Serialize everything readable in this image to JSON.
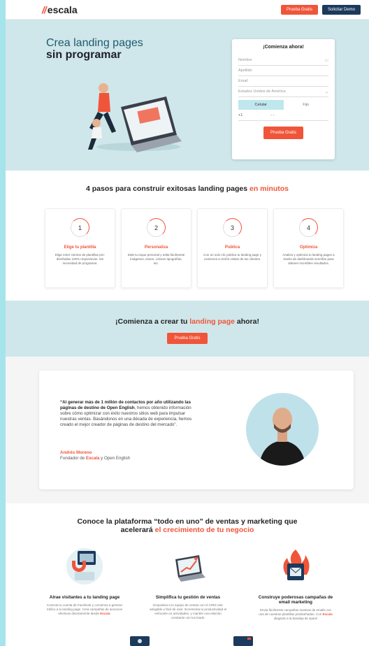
{
  "header": {
    "logo_text": "escala",
    "btn_trial": "Prueba Gratis",
    "btn_demo": "Solicitar Demo"
  },
  "hero": {
    "title_line1": "Crea landing pages",
    "title_line2": "sin programar",
    "form": {
      "title": "¡Comienza ahora!",
      "name_placeholder": "Nombre",
      "lastname_placeholder": "Apellido",
      "email_placeholder": "Email",
      "country_value": "Estados Unidos de América",
      "tab_mobile": "Celular",
      "tab_landline": "Fijo",
      "phone_prefix": "+1",
      "phone_mask": "- -",
      "submit": "Prueba Gratis"
    }
  },
  "steps": {
    "title_main": "4 pasos para construir exitosas landing pages ",
    "title_highlight": "en minutos",
    "items": [
      {
        "num": "1",
        "title": "Elige tu plantilla",
        "desc": "Elige entre cientos de plantillas pre-diseñadas 100% responsivas. Sin necesidad de programar."
      },
      {
        "num": "2",
        "title": "Personaliza",
        "desc": "Dale tu toque personal y edita fácilmente imágenes, textos, colores tipografías, etc."
      },
      {
        "num": "3",
        "title": "Publica",
        "desc": "Con un solo clic publica tu landing page y comienza a recibir visitas de tus clientes."
      },
      {
        "num": "4",
        "title": "Optimiza",
        "desc": "Analiza y optimiza tu landing pages a través de dashboards sencillos para obtener increíbles resultados."
      }
    ]
  },
  "cta": {
    "title_pre": "¡Comienza a crear tu ",
    "title_highlight": "landing page",
    "title_post": " ahora!",
    "button": "Prueba Gratis"
  },
  "testimonial": {
    "quote_bold": "“Al generar más de 1 millón de contactos por año utilizando las páginas de destino de Open English",
    "quote_rest": ", hemos obtenido información sobre cómo optimizar con éxito nuestros sitios web para impulsar nuestras ventas. Basándonos en una década de experiencia, hemos creado el mejor creador de páginas de destino del mercado”.",
    "name": "Andrés Moreno",
    "role_pre": "Fundador de ",
    "role_brand": "Escala",
    "role_post": " y Open English"
  },
  "platform": {
    "title_line1": "Conoce la plataforma “todo en uno” de ventas y marketing que",
    "title_line2_pre": "acelerará ",
    "title_line2_highlight": "el crecimiento de tu negocio",
    "features": [
      {
        "title": "Atrae visitantes a tu landing page",
        "desc_pre": "Conecta tu cuenta de Facebook y comienza a generar tráfico a tu landing page. Crea campañas de anuncios efectivas directamente desde ",
        "desc_brand": "Escala",
        "desc_post": "."
      },
      {
        "title": "Simplifica tu gestión de ventas",
        "desc_pre": "Empodera a tu equipo de ventas con el CRM más amigable y fácil de usar. Incrementa tu productividad al enfocarte en actividades, y mantén una relación constante con tus leads.",
        "desc_brand": "",
        "desc_post": ""
      },
      {
        "title": "Construye poderosas campañas de email marketing",
        "desc_pre": "Envía fácilmente campañas masivas de emails con una de nuestras plantillas prediseñadas. Con ",
        "desc_brand": "Escala",
        "desc_post": " ¡llegarás a la bandeja de spam!"
      }
    ]
  },
  "colors": {
    "accent": "#f0553a",
    "navy": "#1c3a5c",
    "hero_bg": "#cfe7ea",
    "page_edge": "#a6e4ec"
  }
}
